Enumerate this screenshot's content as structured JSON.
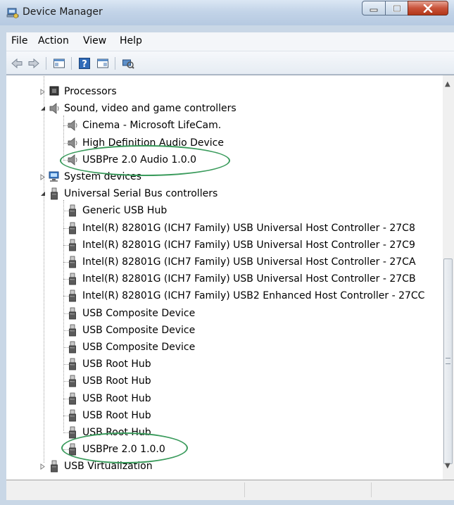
{
  "window": {
    "title": "Device Manager",
    "caption_buttons": {
      "minimize": "–",
      "maximize": "□",
      "close": "X"
    }
  },
  "menubar": {
    "items": [
      "File",
      "Action",
      "View",
      "Help"
    ]
  },
  "toolbar": {
    "icons": [
      "back-arrow-icon",
      "forward-arrow-icon",
      "show-hide-console-tree-icon",
      "help-icon",
      "properties-icon",
      "scan-hardware-icon"
    ]
  },
  "tree": {
    "nodes": [
      {
        "label": "Processors",
        "level": 0,
        "icon": "processor-icon",
        "expander": "collapsed"
      },
      {
        "label": "Sound, video and game controllers",
        "level": 0,
        "icon": "speaker-icon",
        "expander": "expanded"
      },
      {
        "label": "Cinema - Microsoft LifeCam.",
        "level": 1,
        "icon": "speaker-icon"
      },
      {
        "label": "High Definition Audio Device",
        "level": 1,
        "icon": "speaker-icon"
      },
      {
        "label": "USBPre 2.0 Audio 1.0.0",
        "level": 1,
        "icon": "speaker-icon",
        "highlighted": true
      },
      {
        "label": "System devices",
        "level": 0,
        "icon": "computer-icon",
        "expander": "collapsed"
      },
      {
        "label": "Universal Serial Bus controllers",
        "level": 0,
        "icon": "usb-connector-icon",
        "expander": "expanded"
      },
      {
        "label": "Generic USB Hub",
        "level": 1,
        "icon": "usb-connector-icon"
      },
      {
        "label": "Intel(R) 82801G (ICH7 Family) USB Universal Host Controller - 27C8",
        "level": 1,
        "icon": "usb-connector-icon"
      },
      {
        "label": "Intel(R) 82801G (ICH7 Family) USB Universal Host Controller - 27C9",
        "level": 1,
        "icon": "usb-connector-icon"
      },
      {
        "label": "Intel(R) 82801G (ICH7 Family) USB Universal Host Controller - 27CA",
        "level": 1,
        "icon": "usb-connector-icon"
      },
      {
        "label": "Intel(R) 82801G (ICH7 Family) USB Universal Host Controller - 27CB",
        "level": 1,
        "icon": "usb-connector-icon"
      },
      {
        "label": "Intel(R) 82801G (ICH7 Family) USB2 Enhanced Host Controller - 27CC",
        "level": 1,
        "icon": "usb-connector-icon"
      },
      {
        "label": "USB Composite Device",
        "level": 1,
        "icon": "usb-connector-icon"
      },
      {
        "label": "USB Composite Device",
        "level": 1,
        "icon": "usb-connector-icon"
      },
      {
        "label": "USB Composite Device",
        "level": 1,
        "icon": "usb-connector-icon"
      },
      {
        "label": "USB Root Hub",
        "level": 1,
        "icon": "usb-connector-icon"
      },
      {
        "label": "USB Root Hub",
        "level": 1,
        "icon": "usb-connector-icon"
      },
      {
        "label": "USB Root Hub",
        "level": 1,
        "icon": "usb-connector-icon"
      },
      {
        "label": "USB Root Hub",
        "level": 1,
        "icon": "usb-connector-icon"
      },
      {
        "label": "USB Root Hub",
        "level": 1,
        "icon": "usb-connector-icon"
      },
      {
        "label": "USBPre 2.0 1.0.0",
        "level": 1,
        "icon": "usb-connector-icon",
        "highlighted": true
      },
      {
        "label": "USB Virtualization",
        "level": 0,
        "icon": "usb-connector-icon",
        "expander": "collapsed"
      }
    ]
  },
  "colors": {
    "highlight_circle": "#3a9b5c",
    "window_frame": "#c9d7e6",
    "close_button": "#c9533a"
  }
}
